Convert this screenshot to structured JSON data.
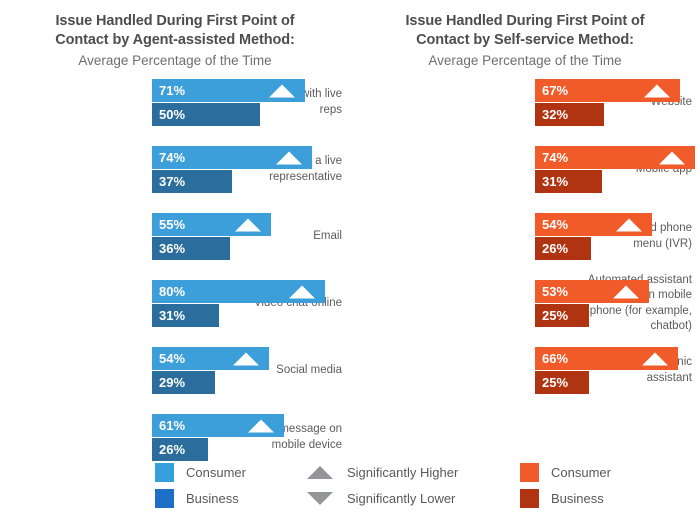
{
  "chart_data": {
    "type": "bar",
    "title": "Issue Handled During First Point of Contact: Average Percentage of the Time",
    "orientation": "horizontal",
    "grid": false,
    "xlim": [
      0,
      100
    ],
    "units": "percent",
    "panels": [
      {
        "id": "agent-assisted",
        "title_line1": "Issue Handled During First Point of",
        "title_line2": "Contact by Agent-assisted Method:",
        "subtitle": "Average Percentage of the Time",
        "colors": {
          "consumer": "#3d9fda",
          "business": "#2b6e9e"
        },
        "categories": [
          "Phone calls with live reps",
          "Chat online with a live representative",
          "Email",
          "Video chat online",
          "Social media",
          "Text message on mobile device"
        ],
        "series": [
          {
            "name": "Consumer",
            "values": [
              71,
              74,
              55,
              80,
              54,
              61
            ]
          },
          {
            "name": "Business",
            "values": [
              50,
              37,
              36,
              31,
              29,
              26
            ]
          }
        ],
        "rows": [
          {
            "label_lines": [
              "Phone calls with live",
              "reps"
            ],
            "consumer": {
              "value": 71,
              "label": "71%",
              "marker": "significantly-higher"
            },
            "business": {
              "value": 50,
              "label": "50%",
              "marker": "none"
            }
          },
          {
            "label_lines": [
              "Chat online with a live",
              "representative"
            ],
            "consumer": {
              "value": 74,
              "label": "74%",
              "marker": "significantly-higher"
            },
            "business": {
              "value": 37,
              "label": "37%",
              "marker": "none"
            }
          },
          {
            "label_lines": [
              "Email"
            ],
            "consumer": {
              "value": 55,
              "label": "55%",
              "marker": "significantly-higher"
            },
            "business": {
              "value": 36,
              "label": "36%",
              "marker": "none"
            }
          },
          {
            "label_lines": [
              "Video chat online"
            ],
            "consumer": {
              "value": 80,
              "label": "80%",
              "marker": "significantly-higher"
            },
            "business": {
              "value": 31,
              "label": "31%",
              "marker": "none"
            }
          },
          {
            "label_lines": [
              "Social media"
            ],
            "consumer": {
              "value": 54,
              "label": "54%",
              "marker": "significantly-higher"
            },
            "business": {
              "value": 29,
              "label": "29%",
              "marker": "none"
            }
          },
          {
            "label_lines": [
              "Text message on",
              "mobile device"
            ],
            "consumer": {
              "value": 61,
              "label": "61%",
              "marker": "significantly-higher"
            },
            "business": {
              "value": 26,
              "label": "26%",
              "marker": "none"
            }
          }
        ]
      },
      {
        "id": "self-service",
        "title_line1": "Issue Handled During First Point of",
        "title_line2": "Contact by Self-service Method:",
        "subtitle": "Average Percentage of the Time",
        "colors": {
          "consumer": "#f15a29",
          "business": "#b03411"
        },
        "categories": [
          "Website",
          "Mobile app",
          "Automated phone menu (IVR)",
          "Automated assistant online or on mobile phone (for example, chatbot)",
          "Home electronic assistant"
        ],
        "series": [
          {
            "name": "Consumer",
            "values": [
              67,
              74,
              54,
              53,
              66
            ]
          },
          {
            "name": "Business",
            "values": [
              32,
              31,
              26,
              25,
              25
            ]
          }
        ],
        "rows": [
          {
            "label_lines": [
              "Website"
            ],
            "consumer": {
              "value": 67,
              "label": "67%",
              "marker": "significantly-higher"
            },
            "business": {
              "value": 32,
              "label": "32%",
              "marker": "none"
            }
          },
          {
            "label_lines": [
              "Mobile app"
            ],
            "consumer": {
              "value": 74,
              "label": "74%",
              "marker": "significantly-higher"
            },
            "business": {
              "value": 31,
              "label": "31%",
              "marker": "none"
            }
          },
          {
            "label_lines": [
              "Automated phone",
              "menu (IVR)"
            ],
            "consumer": {
              "value": 54,
              "label": "54%",
              "marker": "significantly-higher"
            },
            "business": {
              "value": 26,
              "label": "26%",
              "marker": "none"
            }
          },
          {
            "label_lines": [
              "Automated assistant",
              "online or on mobile",
              "phone (for example,",
              "chatbot)"
            ],
            "consumer": {
              "value": 53,
              "label": "53%",
              "marker": "significantly-higher"
            },
            "business": {
              "value": 25,
              "label": "25%",
              "marker": "none"
            }
          },
          {
            "label_lines": [
              "Home electronic",
              "assistant"
            ],
            "consumer": {
              "value": 66,
              "label": "66%",
              "marker": "significantly-higher"
            },
            "business": {
              "value": 25,
              "label": "25%",
              "marker": "none"
            }
          }
        ]
      }
    ],
    "legend": {
      "position": "bottom",
      "blue": [
        {
          "label": "Consumer",
          "color": "#33a0dc"
        },
        {
          "label": "Business",
          "color": "#1f6fc7"
        }
      ],
      "markers": [
        {
          "label": "Significantly Higher",
          "icon": "triangle-up-icon",
          "color": "#939598"
        },
        {
          "label": "Significantly Lower",
          "icon": "triangle-down-icon",
          "color": "#939598"
        }
      ],
      "orange": [
        {
          "label": "Consumer",
          "color": "#f15a29"
        },
        {
          "label": "Business",
          "color": "#b03411"
        }
      ]
    }
  }
}
